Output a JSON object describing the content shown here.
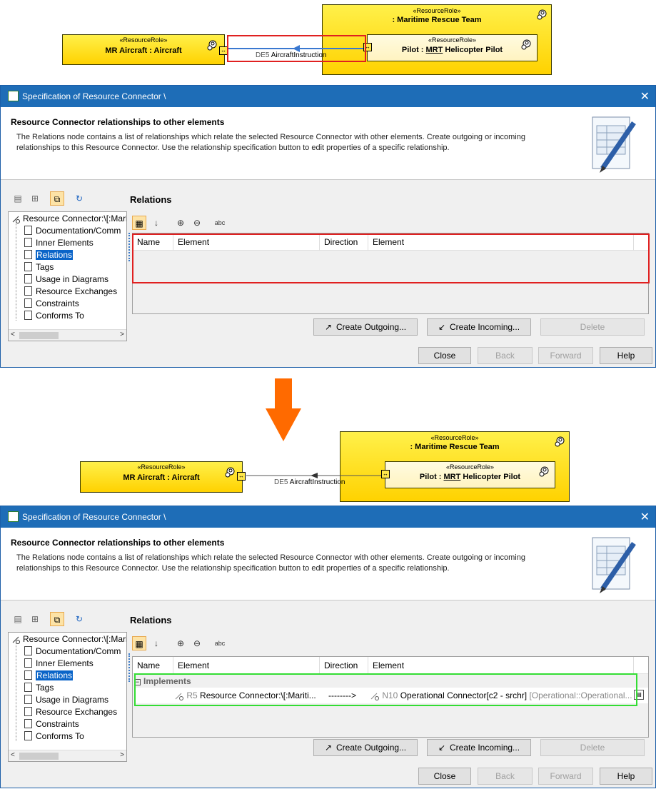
{
  "diagram_before": {
    "team": {
      "stereotype": "«ResourceRole»",
      "name": ": Maritime Rescue Team"
    },
    "aircraft": {
      "stereotype": "«ResourceRole»",
      "name": "MR Aircraft : Aircraft"
    },
    "pilot": {
      "stereotype": "«ResourceRole»",
      "name_prefix": "Pilot : ",
      "name_underlined": "MRT",
      "name_suffix": " Helicopter Pilot"
    },
    "connector_label_prefix": "DE5",
    "connector_label": "AircraftInstruction"
  },
  "diagram_after": {
    "team": {
      "stereotype": "«ResourceRole»",
      "name": ": Maritime Rescue Team"
    },
    "aircraft": {
      "stereotype": "«ResourceRole»",
      "name": "MR Aircraft : Aircraft"
    },
    "pilot": {
      "stereotype": "«ResourceRole»",
      "name_prefix": "Pilot : ",
      "name_underlined": "MRT",
      "name_suffix": " Helicopter Pilot"
    },
    "connector_label_prefix": "DE5",
    "connector_label": "AircraftInstruction"
  },
  "dialog": {
    "title": "Specification of Resource Connector \\",
    "close_glyph": "✕",
    "header_title": "Resource Connector relationships to other elements",
    "header_desc": "The Relations node contains a list of relationships which relate the selected Resource Connector with other elements. Create outgoing or incoming relationships to this Resource Connector. Use the relationship specification button to edit properties of a specific relationship.",
    "tree_root": "Resource Connector:\\[:Mari",
    "tree_items": [
      "Documentation/Comm",
      "Inner Elements",
      "Relations",
      "Tags",
      "Usage in Diagrams",
      "Resource Exchanges",
      "Constraints",
      "Conforms To"
    ],
    "selected_index": 2,
    "section_title": "Relations",
    "columns": [
      "Name",
      "Element",
      "Direction",
      "Element"
    ],
    "buttons": {
      "create_outgoing": "Create Outgoing...",
      "create_incoming": "Create Incoming...",
      "delete": "Delete",
      "close": "Close",
      "back": "Back",
      "forward": "Forward",
      "help": "Help"
    }
  },
  "after_table": {
    "group": "Implements",
    "row": {
      "source_id": "R5",
      "source_name": "Resource Connector:\\[:Mariti...",
      "direction": "-------->",
      "target_id": "N10",
      "target_name": "Operational Connector[c2 - srchr]",
      "target_owner": "[Operational::Operational..."
    }
  },
  "colors": {
    "title_blue": "#1e6db7",
    "highlight_red": "#e02020",
    "highlight_green": "#33dd33",
    "arrow_orange": "#ff6a00",
    "role_yellow": "#ffe000"
  }
}
